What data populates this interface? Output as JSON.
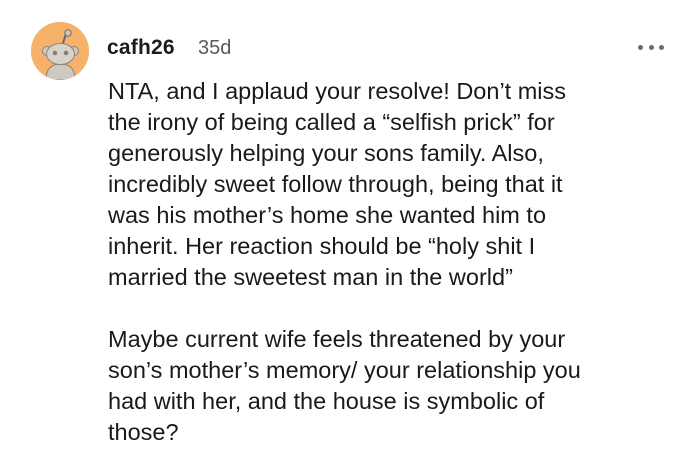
{
  "comment": {
    "author": "cafh26",
    "age": "35d",
    "avatar_icon": "snoo-avatar-icon",
    "avatar_color": "#f6b26b",
    "more_icon": "more-options-icon",
    "paragraphs": [
      {
        "lines": [
          "NTA, and I applaud your resolve! Don’t miss",
          "the irony of being called a “selfish prick” for",
          "generously helping your sons family. Also,",
          "incredibly sweet follow through, being that it",
          "was his mother’s home she wanted him to",
          "inherit. Her reaction should be “holy shit I",
          "married the sweetest man in the world”"
        ]
      },
      {
        "lines": [
          "Maybe current wife feels threatened by your",
          "son’s mother’s memory/ your relationship you",
          "had with her, and the house is symbolic of",
          "those?"
        ]
      }
    ]
  }
}
